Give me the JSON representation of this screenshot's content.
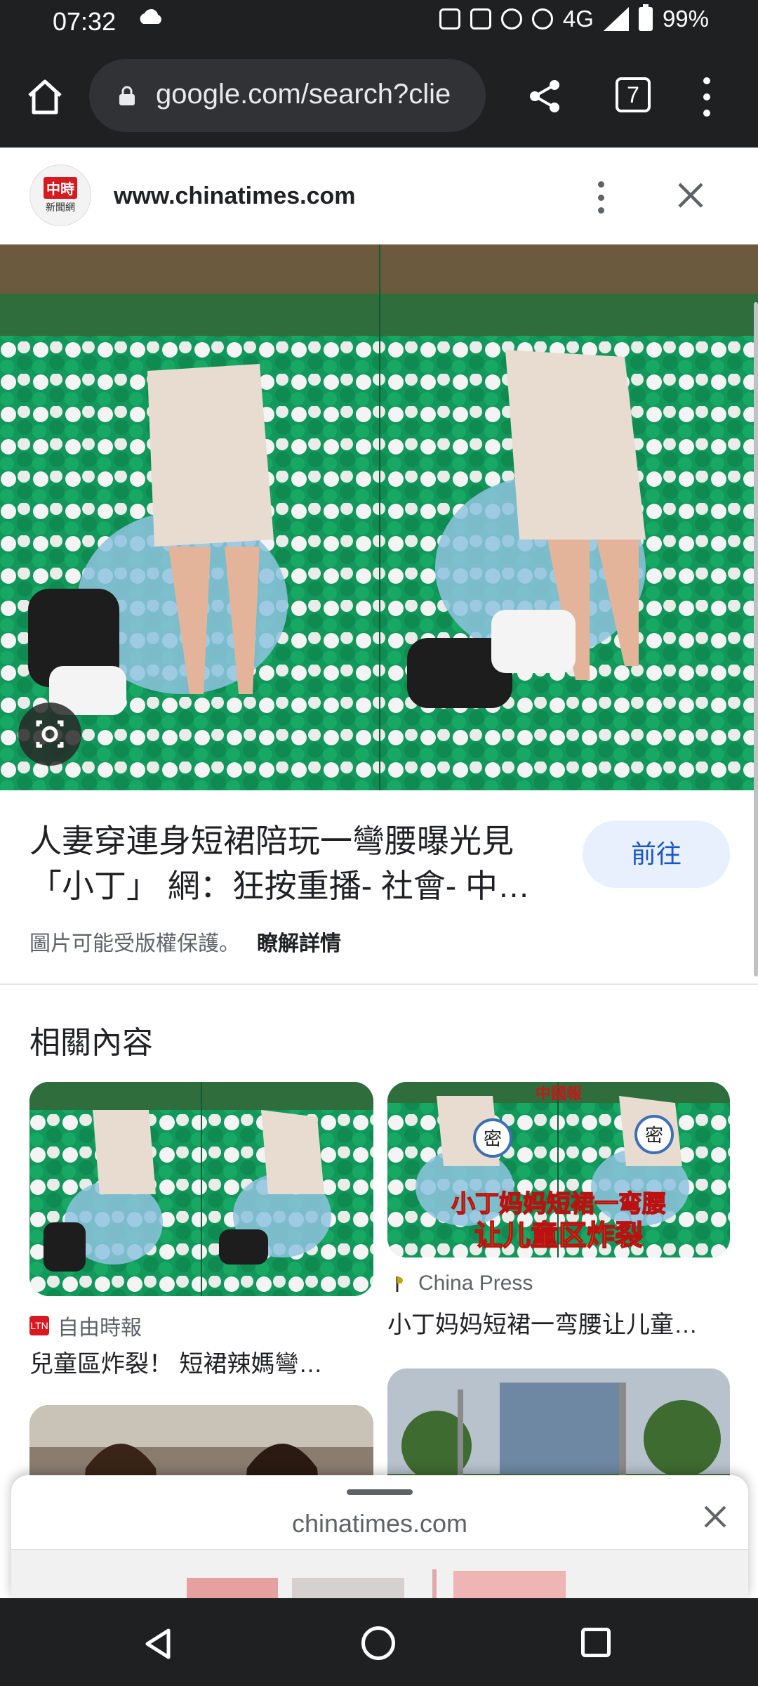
{
  "status_bar": {
    "time": "07:32",
    "network": "4G",
    "battery": "99%"
  },
  "browser": {
    "url": "google.com/search?clie",
    "tab_count": "7"
  },
  "result": {
    "site_domain": "www.chinatimes.com",
    "site_logo_line1": "中時",
    "site_logo_line2": "新聞網",
    "title": "人妻穿連身短裙陪玩一彎腰曝光見「小丁」 網：狂按重播- 社會- 中…",
    "go_button": "前往",
    "copyright_notice": "圖片可能受版權保護。",
    "learn_more": "瞭解詳情"
  },
  "related": {
    "heading": "相關內容",
    "items": [
      {
        "source": "自由時報",
        "source_icon_text": "LTN",
        "title": "兒童區炸裂！ 短裙辣媽彎…"
      },
      {
        "source": "China Press",
        "title": "小丁妈妈短裙一弯腰让儿童…",
        "image_banner": "中國報",
        "image_caption_line1": "小丁妈妈短裙一弯腰",
        "image_caption_line2": "让儿童区炸裂",
        "blur_label": "密"
      }
    ]
  },
  "bottom_sheet": {
    "domain": "chinatimes.com"
  },
  "colors": {
    "chrome_dark": "#1f2022",
    "accent_blue": "#1a56c8",
    "button_bg": "#e8f0fe",
    "ball_green": "#13a060"
  }
}
